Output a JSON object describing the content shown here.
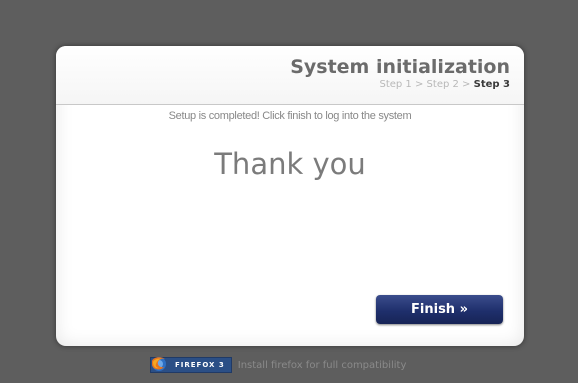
{
  "header": {
    "title": "System initialization",
    "steps": [
      {
        "label": "Step 1"
      },
      {
        "label": "Step 2"
      },
      {
        "label": "Step 3"
      }
    ],
    "separator": ">"
  },
  "content": {
    "message": "Setup is completed! Click finish to log into the system",
    "thanks": "Thank you"
  },
  "actions": {
    "finish_label": "Finish »"
  },
  "footer": {
    "badge_label": "FIREFOX 3",
    "note": "Install firefox for full compatibility"
  },
  "icons": {
    "firefox": "firefox-logo-icon"
  },
  "colors": {
    "background": "#5e5e5e",
    "finish_button": "#1f2f6c",
    "badge": "#2b4f86"
  }
}
